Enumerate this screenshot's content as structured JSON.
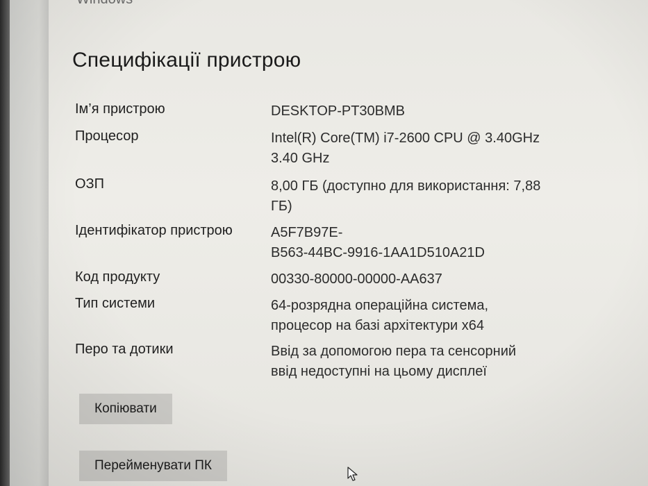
{
  "header": {
    "cutoff_title": "Windows"
  },
  "section": {
    "title": "Специфікації пристрою"
  },
  "specs": [
    {
      "label": "Ім’я пристрою",
      "value": "DESKTOP-PT30BMB"
    },
    {
      "label": "Процесор",
      "value": "Intel(R) Core(TM) i7-2600 CPU @ 3.40GHz\n3.40 GHz"
    },
    {
      "label": "ОЗП",
      "value": "8,00 ГБ (доступно для використання: 7,88\nГБ)"
    },
    {
      "label": "Ідентифікатор пристрою",
      "value": "A5F7B97E-\nB563-44BC-9916-1AA1D510A21D"
    },
    {
      "label": "Код продукту",
      "value": "00330-80000-00000-AA637"
    },
    {
      "label": "Тип системи",
      "value": "64-розрядна операційна система,\nпроцесор на базі архітектури x64"
    },
    {
      "label": "Перо та дотики",
      "value": "Ввід за допомогою пера та сенсорний\nввід недоступні на цьому дисплеї"
    }
  ],
  "buttons": {
    "copy_label": "Копіювати",
    "rename_label": "Перейменувати ПК"
  },
  "icons": {
    "cursor": "mouse-pointer-icon"
  },
  "colors": {
    "background": "#eceae6",
    "button_bg": "#cbcac6",
    "text": "#1c1c1c"
  }
}
